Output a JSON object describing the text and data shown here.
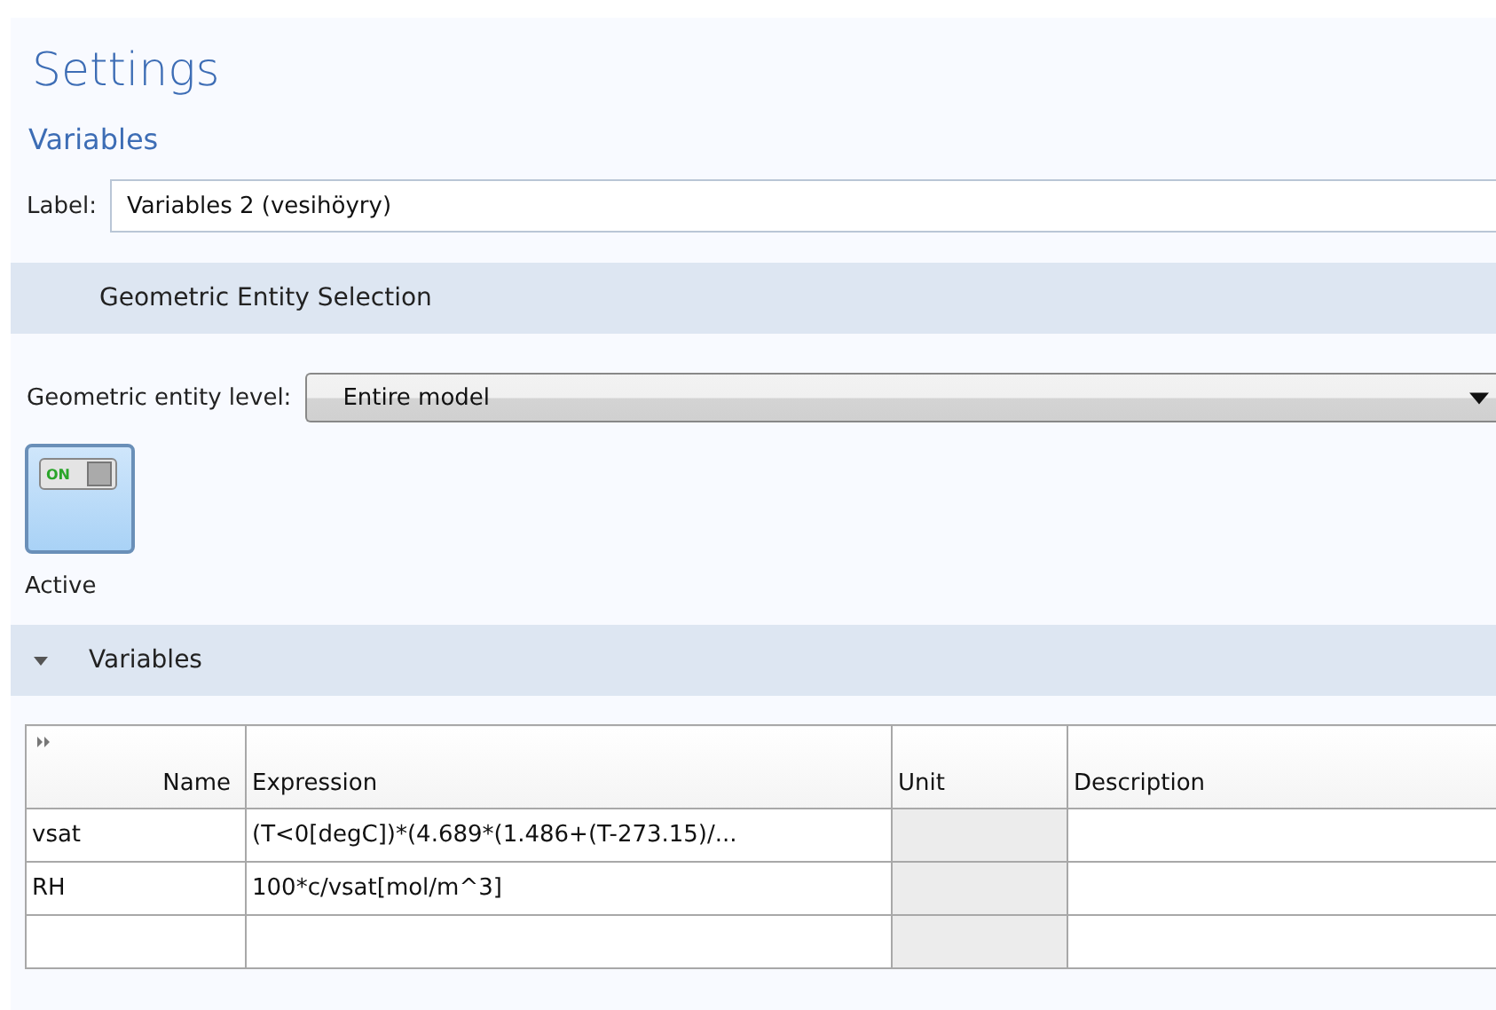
{
  "title": "Settings",
  "subtitle": "Variables",
  "label_field": {
    "label": "Label:",
    "value": "Variables 2 (vesihöyry)"
  },
  "sections": [
    {
      "title": "Geometric Entity Selection",
      "kind": "plain"
    },
    {
      "title": "Variables",
      "kind": "collapsible",
      "expanded": true
    }
  ],
  "entity_level": {
    "label": "Geometric entity level:",
    "value": "Entire model"
  },
  "active_toggle": {
    "on": true,
    "badge": "ON",
    "label": "Active"
  },
  "table": {
    "columns": [
      "Name",
      "Expression",
      "Unit",
      "Description"
    ],
    "rows": [
      {
        "name": "vsat",
        "expression": "(T<0[degC])*(4.689*(1.486+(T-273.15)/..."
      },
      {
        "name": "RH",
        "expression": "100*c/vsat[mol/m^3]"
      }
    ]
  }
}
